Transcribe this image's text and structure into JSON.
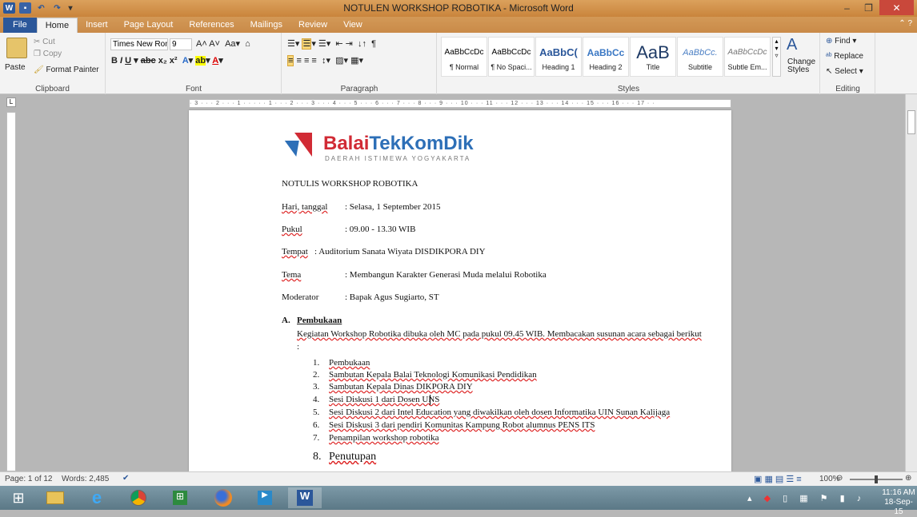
{
  "window": {
    "title": "NOTULEN WORKSHOP ROBOTIKA - Microsoft Word"
  },
  "tabs": [
    "File",
    "Home",
    "Insert",
    "Page Layout",
    "References",
    "Mailings",
    "Review",
    "View"
  ],
  "clipboard": {
    "paste": "Paste",
    "cut": "Cut",
    "copy": "Copy",
    "format_painter": "Format Painter",
    "label": "Clipboard"
  },
  "font": {
    "name": "Times New Rom",
    "size": "9",
    "label": "Font"
  },
  "paragraph": {
    "label": "Paragraph"
  },
  "styles": {
    "label": "Styles",
    "change": "Change Styles",
    "items": [
      {
        "preview": "AaBbCcDc",
        "name": "¶ Normal"
      },
      {
        "preview": "AaBbCcDc",
        "name": "¶ No Spaci..."
      },
      {
        "preview": "AaBbC(",
        "name": "Heading 1"
      },
      {
        "preview": "AaBbCc",
        "name": "Heading 2"
      },
      {
        "preview": "AaB",
        "name": "Title"
      },
      {
        "preview": "AaBbCc.",
        "name": "Subtitle"
      },
      {
        "preview": "AaBbCcDc",
        "name": "Subtle Em..."
      }
    ]
  },
  "editing": {
    "find": "Find",
    "replace": "Replace",
    "select": "Select",
    "label": "Editing"
  },
  "ruler": {
    "marks": "· 3 · · · 2 · · · 1 · · · · · 1 · · · 2 · · · 3 · · · 4 · · · 5 · · · 6 · · · 7 · · · 8 · · · 9 · · · 10 · · · 11 · · · 12 · · · 13 · · · 14 · · · 15 · · · 16 · · · 17 · ·"
  },
  "document": {
    "logo_main_a": "Balai",
    "logo_main_b": "TekKomDik",
    "logo_sub": "DAERAH ISTIMEWA YOGYAKARTA",
    "heading": "NOTULIS WORKSHOP ROBOTIKA",
    "fields": [
      {
        "label": "Hari, tanggal",
        "value": ": Selasa, 1 September 2015"
      },
      {
        "label": "Pukul",
        "value": ": 09.00 - 13.30 WIB"
      },
      {
        "label": "Tempat",
        "value": ": Auditorium Sanata Wiyata DISDIKPORA DIY"
      },
      {
        "label": "Tema",
        "value": ": Membangun Karakter Generasi Muda melalui Robotika"
      },
      {
        "label": "Moderator",
        "value": ": Bapak Agus Sugiarto, ST"
      }
    ],
    "section_letter": "A.",
    "section_title": "Pembukaan",
    "para": "Kegiatan Workshop Robotika dibuka oleh MC pada pukul 09.45 WIB.  Membacakan susunan acara sebagai berikut",
    "para_end": ":",
    "items": [
      {
        "n": "1.",
        "t": "Pembukaan"
      },
      {
        "n": "2.",
        "t": "Sambutan Kepala Balai Teknologi Komunikasi Pendidikan"
      },
      {
        "n": "3.",
        "t": "Sambutan Kepala Dinas DIKPORA DIY"
      },
      {
        "n": "4.",
        "t": "Sesi Diskusi 1 dari Dosen UNS"
      },
      {
        "n": "5.",
        "t": "Sesi Diskusi 2 dari Intel Education yang diwakilkan oleh dosen Informatika UIN Sunan Kalijaga"
      },
      {
        "n": "6.",
        "t": "Sesi Diskusi 3 dari pendiri Komunitas Kampung Robot alumnus PENS ITS"
      },
      {
        "n": "7.",
        "t": "Penampilan workshop robotika"
      },
      {
        "n": "8.",
        "t": "Penutupan"
      }
    ]
  },
  "status": {
    "page": "Page: 1 of 12",
    "words": "Words: 2,485",
    "zoom": "100%"
  },
  "clock": {
    "time": "11:16 AM",
    "date": "18-Sep-15"
  },
  "colors": {
    "accent": "#2b579a",
    "title_bar": "#d39957",
    "logo_red": "#d12b35",
    "logo_blue": "#2d6fb7"
  }
}
